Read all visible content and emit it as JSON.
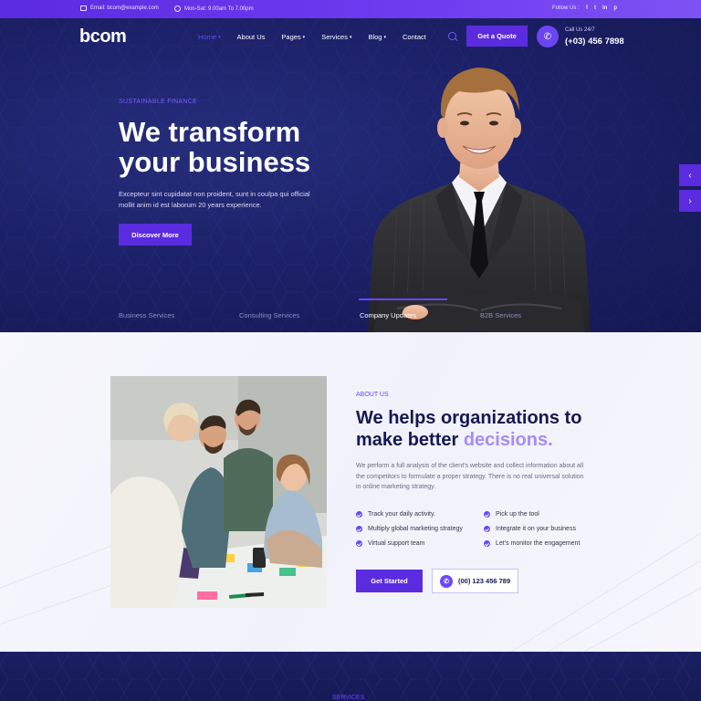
{
  "topbar": {
    "email": "Email: bcom@example.com",
    "hours": "Mon-Sat: 9.00am To 7.00pm",
    "follow": "Follow Us :",
    "social_icons": [
      "f",
      "t",
      "in",
      "p"
    ]
  },
  "nav": {
    "logo": "bcom",
    "items": [
      {
        "label": "Home",
        "caret": true
      },
      {
        "label": "About Us",
        "caret": false
      },
      {
        "label": "Pages",
        "caret": true
      },
      {
        "label": "Services",
        "caret": true
      },
      {
        "label": "Blog",
        "caret": true
      },
      {
        "label": "Contact",
        "caret": false
      }
    ],
    "quote_button": "Get a Quote",
    "call_label": "Call Us 24/7",
    "call_number": "(+03) 456 7898"
  },
  "hero": {
    "eyebrow": "SUSTAINABLE FINANCE",
    "title": "We transform your business",
    "text": "Excepteur sint cupidatat non proident, sunt in coulpa qui official mollit anim id est laborum 20 years experience.",
    "button": "Discover More",
    "tabs": [
      "Business Services",
      "Consulting Services",
      "Company Updates",
      "B2B Services"
    ],
    "active_tab": "Company Updates"
  },
  "about": {
    "eyebrow": "ABOUT US",
    "title_main": "We helps organizations to make better ",
    "title_highlight": "decisions.",
    "text": "We perform a full analysis of the client's website and collect information about all the competitors to formulate a proper strategy. There is no real universal solution in online marketing strategy.",
    "features_left": [
      "Track your daily activity.",
      "Multiply global marketing strategy",
      "Virtual support team"
    ],
    "features_right": [
      "Pick up the tool",
      "Integrate it on your business",
      "Let's monitor the engagement"
    ],
    "button": "Get Started",
    "phone": "(00) 123 456 789"
  },
  "services": {
    "label": "SERVICES"
  },
  "colors": {
    "accent": "#5b2be0",
    "hero_bg": "#1c2168",
    "heading": "#141852"
  }
}
